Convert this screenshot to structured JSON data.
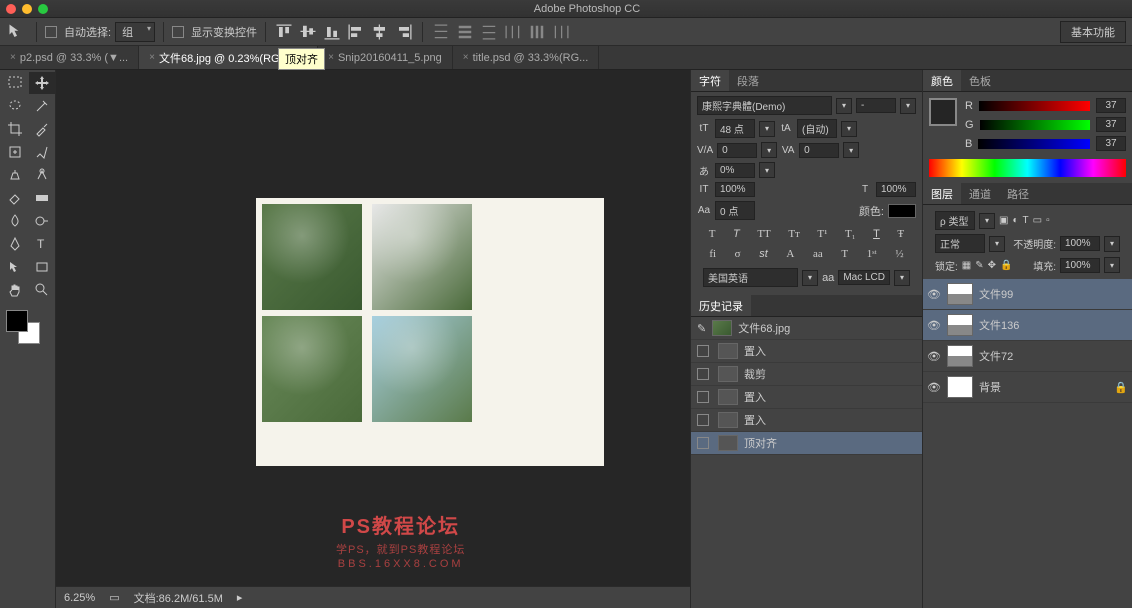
{
  "app": {
    "title": "Adobe Photoshop CC"
  },
  "options": {
    "auto_select": "自动选择:",
    "group": "组",
    "show_transform": "显示变换控件",
    "tooltip": "顶对齐",
    "workspace": "基本功能"
  },
  "tabs": [
    {
      "label": "p2.psd @ 33.3% (▼..."
    },
    {
      "label": "文件68.jpg @ 0.23%(RGB/8) *",
      "active": true
    },
    {
      "label": "Snip20160411_5.png"
    },
    {
      "label": "title.psd @ 33.3%(RG..."
    }
  ],
  "watermark": {
    "title": "PS教程论坛",
    "sub": "学PS，就到PS教程论坛",
    "url": "BBS.16XX8.COM"
  },
  "status": {
    "zoom": "6.25%",
    "doc": "文档:86.2M/61.5M"
  },
  "char_panel": {
    "tab1": "字符",
    "tab2": "段落",
    "font": "康熙字典體(Demo)",
    "style": "-",
    "size_label": "tT",
    "size": "48 点",
    "leading_label": "tA",
    "leading": "(自动)",
    "va": "VA",
    "kerning": "0",
    "tracking": "0",
    "scale_label": "あ",
    "scale": "0%",
    "h_scale": "100%",
    "v_scale": "100%",
    "baseline_label": "Aa",
    "baseline": "0 点",
    "color_label": "颜色:",
    "lang": "美国英语",
    "aa": "aa",
    "render": "Mac LCD"
  },
  "history": {
    "tab": "历史记录",
    "doc": "文件68.jpg",
    "items": [
      "置入",
      "裁剪",
      "置入",
      "置入",
      "顶对齐"
    ]
  },
  "color": {
    "tab1": "颜色",
    "tab2": "色板",
    "r": "R",
    "g": "G",
    "b": "B",
    "rv": "37",
    "gv": "37",
    "bv": "37"
  },
  "layers": {
    "tab1": "图层",
    "tab2": "通道",
    "tab3": "路径",
    "filter": "ρ 类型",
    "blend": "正常",
    "opacity_label": "不透明度:",
    "opacity": "100%",
    "lock_label": "锁定:",
    "fill_label": "填充:",
    "fill": "100%",
    "items": [
      {
        "name": "文件99",
        "sel": true
      },
      {
        "name": "文件136",
        "sel": true
      },
      {
        "name": "文件72"
      },
      {
        "name": "背景"
      }
    ]
  }
}
